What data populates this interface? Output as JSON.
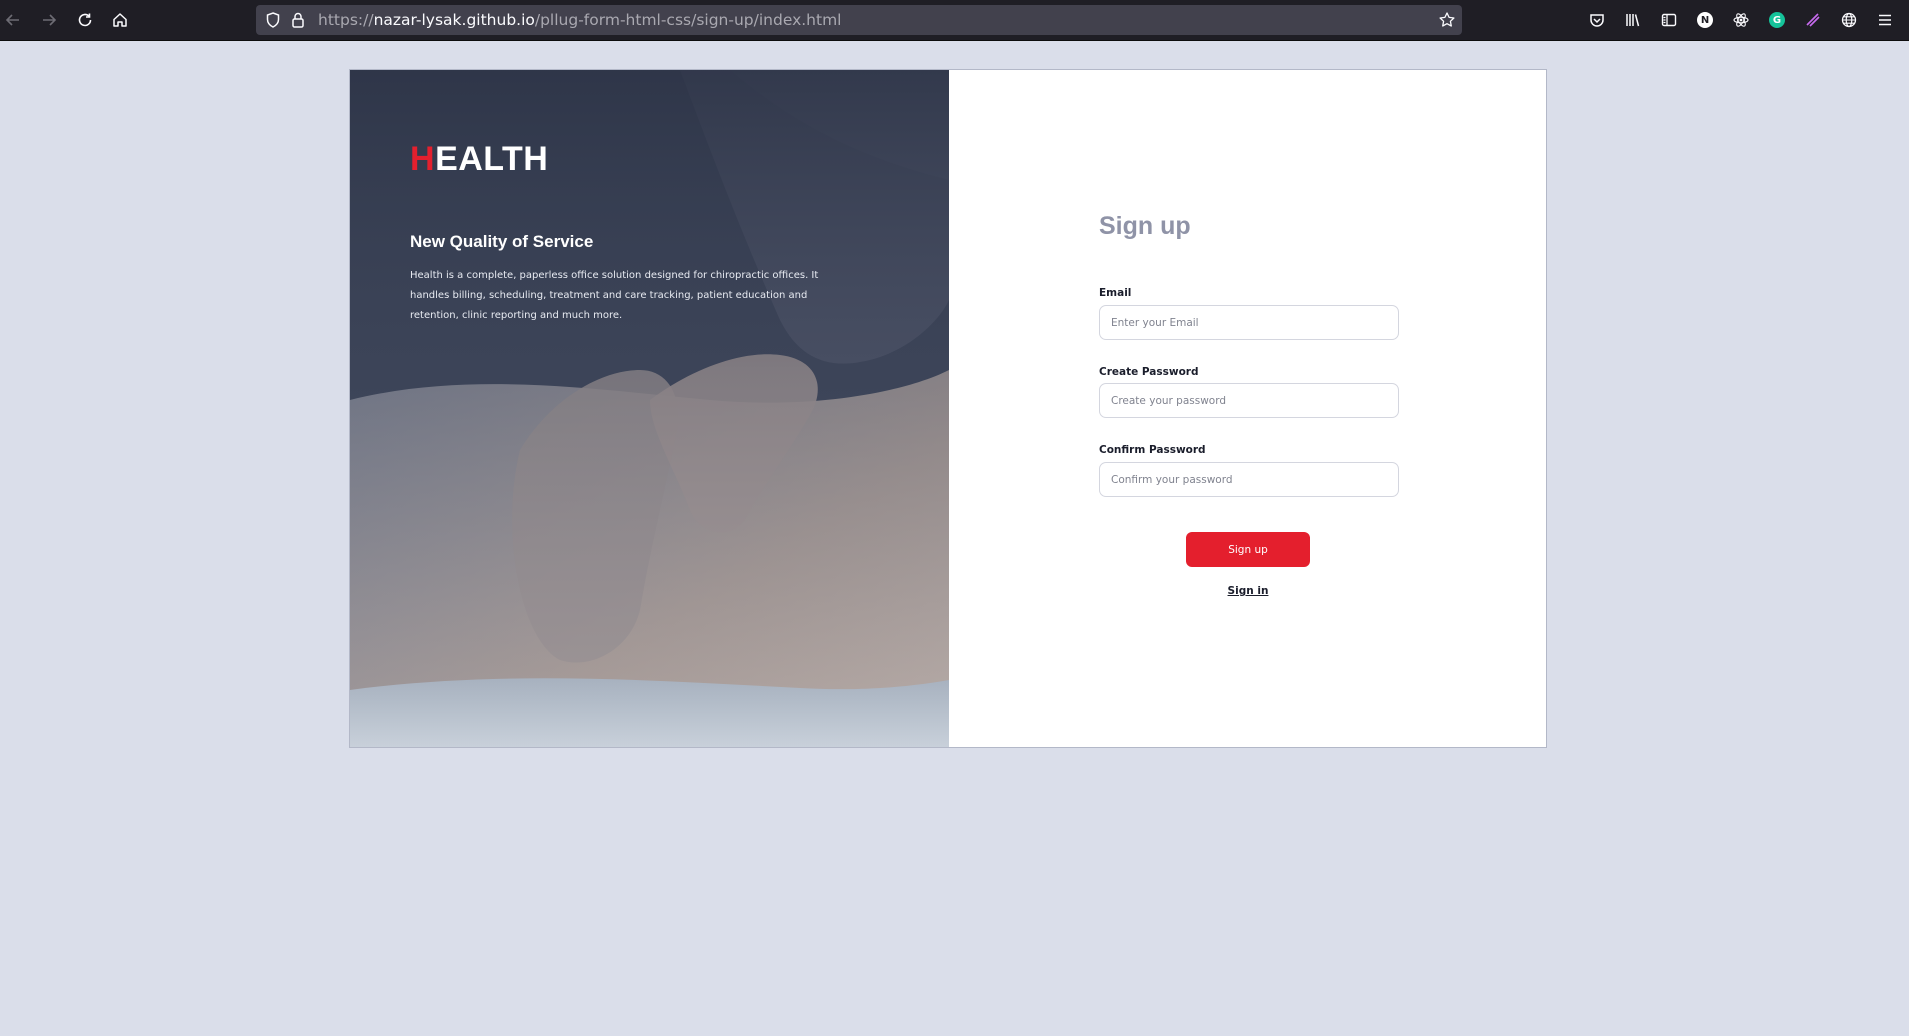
{
  "browser": {
    "url_prefix": "https://",
    "url_host": "nazar-lysak.github.io",
    "url_path": "/pllug-form-html-css/sign-up/index.html",
    "extension_n_letter": "N",
    "extension_g_letter": "G"
  },
  "hero": {
    "brand_first": "H",
    "brand_rest": "EALTH",
    "title": "New Quality of Service",
    "description": "Health is a complete, paperless office solution designed for chiropractic offices. It handles billing, scheduling, treatment and care tracking, patient education and retention, clinic reporting and much more."
  },
  "form": {
    "title": "Sign up",
    "email_label": "Email",
    "email_placeholder": "Enter your Email",
    "password_label": "Create Password",
    "password_placeholder": "Create your password",
    "confirm_label": "Confirm Password",
    "confirm_placeholder": "Confirm your password",
    "submit_label": "Sign up",
    "signin_label": "Sign in"
  },
  "colors": {
    "page_background": "#dadeea",
    "accent": "#e41f2d",
    "form_title": "#8f93a7"
  }
}
